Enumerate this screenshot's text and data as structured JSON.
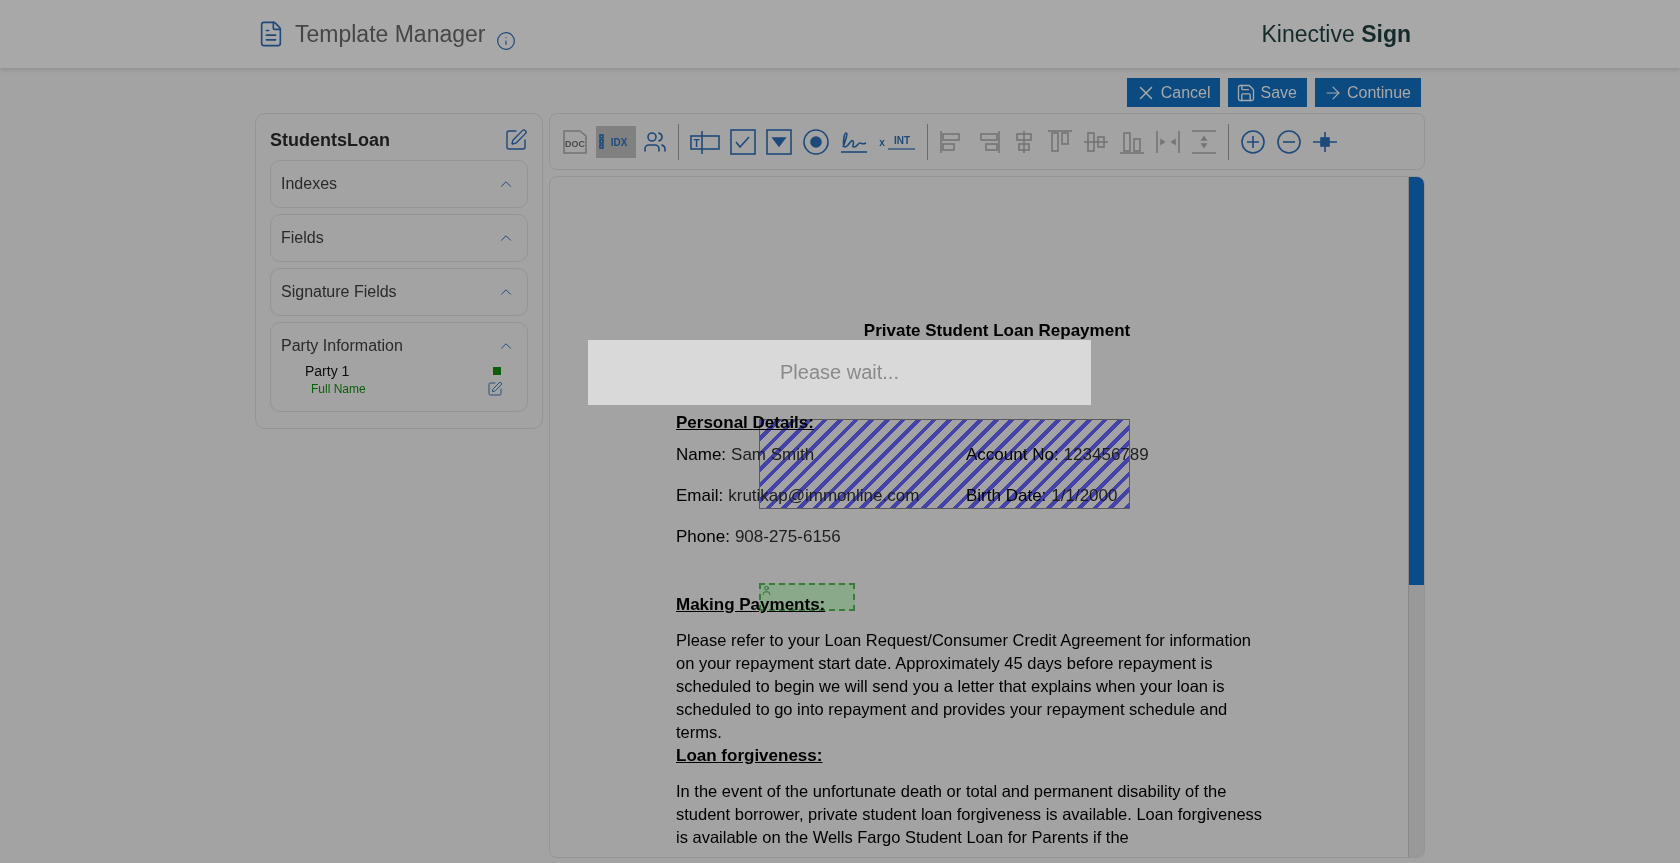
{
  "header": {
    "title": "Template Manager",
    "brand": "Kinective **Sign**"
  },
  "actions": [
    {
      "kind": "cancel",
      "label": "Cancel"
    },
    {
      "kind": "save",
      "label": "Save"
    },
    {
      "kind": "continue",
      "label": "Continue"
    }
  ],
  "sidebar": {
    "title": "StudentsLoan",
    "sections": [
      {
        "label": "Indexes",
        "expanded": true
      },
      {
        "label": "Fields",
        "expanded": true
      },
      {
        "label": "Signature Fields",
        "expanded": true
      },
      {
        "label": "Party Information",
        "expanded": true,
        "parties": [
          {
            "name": "Party 1",
            "color": "#0b5e0b",
            "fields": [
              "Full Name"
            ]
          }
        ]
      }
    ]
  },
  "toolbar": [
    {
      "kind": "doc",
      "label": "DOC",
      "disabled": true,
      "selected": false
    },
    {
      "kind": "idx",
      "label": "IDX",
      "disabled": false,
      "selected": true
    },
    {
      "kind": "parties",
      "disabled": false,
      "selected": false
    },
    {
      "kind": "separator"
    },
    {
      "kind": "textfield",
      "label": "T",
      "disabled": false,
      "selected": false
    },
    {
      "kind": "checkbox",
      "disabled": false,
      "selected": false
    },
    {
      "kind": "dropdown",
      "disabled": false,
      "selected": false
    },
    {
      "kind": "radio",
      "disabled": false,
      "selected": false
    },
    {
      "kind": "signature",
      "disabled": false,
      "selected": false
    },
    {
      "kind": "initials",
      "prefix": "x",
      "label": "INT",
      "disabled": false,
      "selected": false
    },
    {
      "kind": "separator"
    },
    {
      "kind": "align-left",
      "disabled": true,
      "selected": false
    },
    {
      "kind": "align-right",
      "disabled": true,
      "selected": false
    },
    {
      "kind": "align-center",
      "disabled": true,
      "selected": false
    },
    {
      "kind": "align-top",
      "disabled": true,
      "selected": false
    },
    {
      "kind": "align-middle",
      "disabled": true,
      "selected": false
    },
    {
      "kind": "align-bottom",
      "disabled": true,
      "selected": false
    },
    {
      "kind": "space-h",
      "disabled": true,
      "selected": false
    },
    {
      "kind": "space-v",
      "disabled": true,
      "selected": false
    },
    {
      "kind": "separator"
    },
    {
      "kind": "zoom-in",
      "disabled": false,
      "selected": false
    },
    {
      "kind": "zoom-out",
      "disabled": false,
      "selected": false
    },
    {
      "kind": "crosshair",
      "disabled": false,
      "selected": false
    }
  ],
  "document": {
    "title": "Private Student Loan Repayment",
    "blocks": [
      {
        "kind": "heading",
        "text": "Personal Details:"
      },
      {
        "kind": "fields",
        "pairs": [
          {
            "label": "Name:",
            "value": "Sam Smith"
          },
          {
            "label": "Account No:",
            "value": "123456789"
          }
        ],
        "placed_field": {
          "kind": "hatched"
        }
      },
      {
        "kind": "fields",
        "pairs": [
          {
            "label": "Email:",
            "value": "krutikap@immonline.com"
          },
          {
            "label": "Birth Date:",
            "value": "1/1/2000"
          }
        ]
      },
      {
        "kind": "fields",
        "pairs": [
          {
            "label": "Phone:",
            "value": "908-275-6156"
          }
        ]
      },
      {
        "kind": "heading",
        "text": "Making Payments:",
        "placed_field": {
          "kind": "party"
        }
      },
      {
        "kind": "paragraph",
        "text": "Please refer to your Loan Request/Consumer Credit Agreement for information on your repayment start date. Approximately 45 days before repayment is scheduled to begin we will send you a letter that explains when your loan is scheduled to go into repayment and provides your repayment schedule and terms."
      },
      {
        "kind": "heading",
        "text": "Loan forgiveness:"
      },
      {
        "kind": "paragraph",
        "text": "In the event of the unfortunate death or total and permanent disability of the student borrower, private student loan forgiveness is available. Loan forgiveness is available on the Wells Fargo Student Loan for Parents if the"
      }
    ]
  },
  "loading": {
    "message": "Please wait..."
  }
}
